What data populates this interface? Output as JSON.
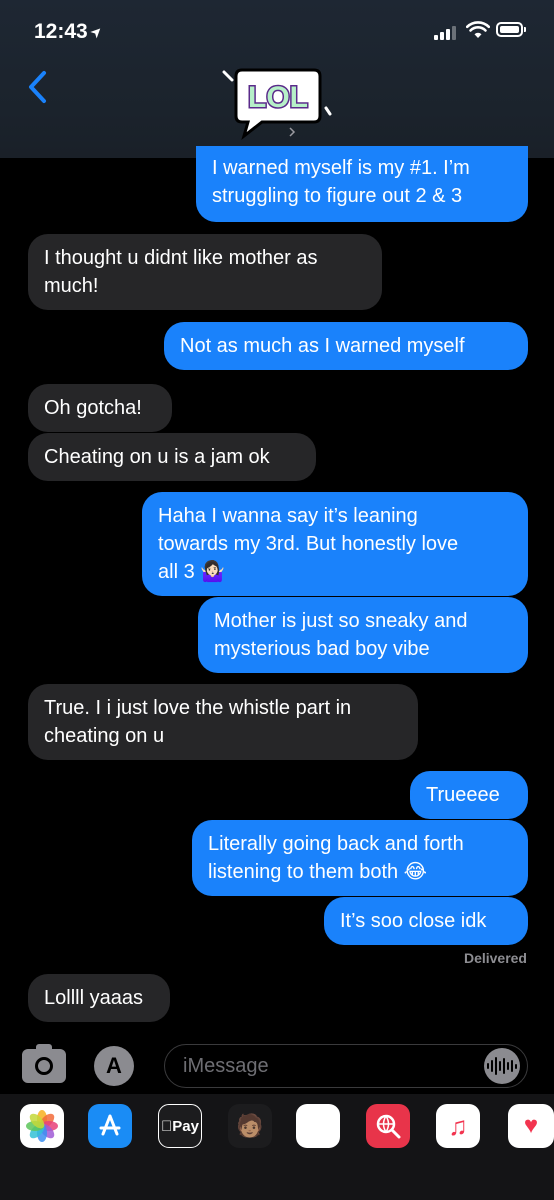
{
  "status_bar": {
    "time": "12:43"
  },
  "contact": {
    "avatar_text": "LOL"
  },
  "messages": [
    {
      "side": "out",
      "text": "I warned myself is my #1. I’m\nstruggling to figure out 2 & 3"
    },
    {
      "side": "in",
      "text": "I thought u didnt like mother as\nmuch!"
    },
    {
      "side": "out",
      "text": "Not as much as I warned myself"
    },
    {
      "side": "in",
      "text": "Oh gotcha!"
    },
    {
      "side": "in",
      "text": "Cheating on u is a jam ok"
    },
    {
      "side": "out",
      "text": "Haha I wanna say it’s leaning\ntowards my 3rd. But honestly love\nall 3 🤷🏻‍♀️"
    },
    {
      "side": "out",
      "text": "Mother is just so sneaky and\nmysterious bad boy vibe"
    },
    {
      "side": "in",
      "text": "True. I i just love the whistle part in\ncheating on u"
    },
    {
      "side": "out",
      "text": "Trueeee"
    },
    {
      "side": "out",
      "text": "Literally going back and forth\nlistening to them both 😂"
    },
    {
      "side": "out",
      "text": "It’s soo close idk"
    },
    {
      "side": "in",
      "text": "Lollll yaaas"
    }
  ],
  "delivered_label": "Delivered",
  "input": {
    "placeholder": "iMessage",
    "value": ""
  },
  "app_drawer": {
    "items": [
      {
        "name": "photos",
        "icon": "photos-icon"
      },
      {
        "name": "app-store",
        "icon": "app-store-icon"
      },
      {
        "name": "apple-pay",
        "icon": "apple-pay-icon",
        "label": "Pay"
      },
      {
        "name": "memoji-stickers",
        "icon": "memoji-icon"
      },
      {
        "name": "animoji",
        "icon": "monkey-icon"
      },
      {
        "name": "web-images",
        "icon": "globe-search-icon"
      },
      {
        "name": "music",
        "icon": "music-icon"
      },
      {
        "name": "digital-touch",
        "icon": "heart-icon"
      }
    ]
  },
  "colors": {
    "outgoing": "#1a82fb",
    "incoming": "#262628",
    "accent": "#1a82fb"
  }
}
